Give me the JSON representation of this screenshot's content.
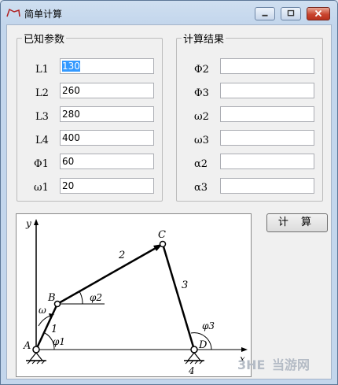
{
  "window": {
    "title": "简单计算"
  },
  "known": {
    "title": "已知参数",
    "rows": [
      {
        "label": "L1",
        "value": "130"
      },
      {
        "label": "L2",
        "value": "260"
      },
      {
        "label": "L3",
        "value": "280"
      },
      {
        "label": "L4",
        "value": "400"
      },
      {
        "label": "Φ1",
        "value": "60"
      },
      {
        "label": "ω1",
        "value": "20"
      }
    ]
  },
  "results": {
    "title": "计算结果",
    "rows": [
      {
        "label": "Φ2",
        "value": ""
      },
      {
        "label": "Φ3",
        "value": ""
      },
      {
        "label": "ω2",
        "value": ""
      },
      {
        "label": "ω3",
        "value": ""
      },
      {
        "label": "α2",
        "value": ""
      },
      {
        "label": "α3",
        "value": ""
      }
    ]
  },
  "calculate_label": "计 算",
  "diagram": {
    "labels": {
      "y": "y",
      "A": "A",
      "B": "B",
      "C": "C",
      "D": "D",
      "link1": "1",
      "link2": "2",
      "link3": "3",
      "link4": "4",
      "phi1": "φ1",
      "phi2": "φ2",
      "phi3": "φ3",
      "omega": "ω",
      "x": "x"
    }
  },
  "watermark": {
    "text": "当游网",
    "logo": "3HE"
  }
}
